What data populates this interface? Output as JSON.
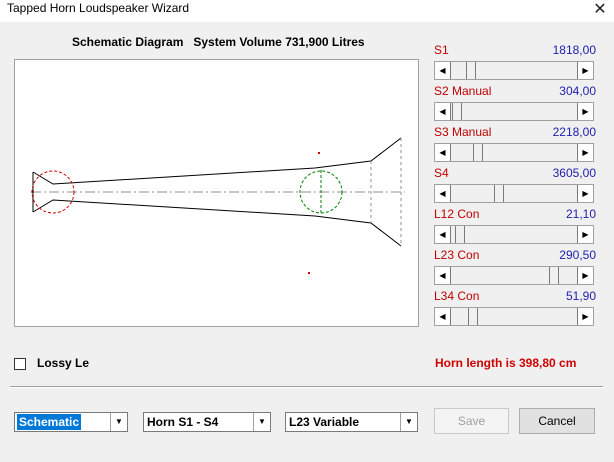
{
  "window": {
    "title": "Tapped Horn Loudspeaker Wizard",
    "close_glyph": "✕"
  },
  "schematic": {
    "title": "Schematic Diagram   System Volume 731,900 Litres"
  },
  "params": [
    {
      "label": "S1",
      "value": "1818,00",
      "fraction": 0.12
    },
    {
      "label": "S2  Manual",
      "value": "304,00",
      "fraction": 0.0
    },
    {
      "label": "S3  Manual",
      "value": "2218,00",
      "fraction": 0.18
    },
    {
      "label": "S4",
      "value": "3605,00",
      "fraction": 0.37
    },
    {
      "label": "L12  Con",
      "value": "21,10",
      "fraction": 0.03
    },
    {
      "label": "L23  Con",
      "value": "290,50",
      "fraction": 0.85
    },
    {
      "label": "L34  Con",
      "value": "51,90",
      "fraction": 0.14
    }
  ],
  "lossy": {
    "label": "Lossy Le",
    "checked": false
  },
  "horn_length": "Horn length is 398,80 cm",
  "combos": {
    "view": "Schematic",
    "horn": "Horn S1 - S4",
    "variable": "L23 Variable"
  },
  "buttons": {
    "save": "Save",
    "cancel": "Cancel"
  },
  "colors": {
    "label_red": "#c00000",
    "value_blue": "#2020b0",
    "horn_length_red": "#d00000",
    "selection_blue": "#0078d7"
  },
  "icons": {
    "scroll_left": "◀",
    "scroll_right": "▶",
    "dropdown": "▼"
  }
}
